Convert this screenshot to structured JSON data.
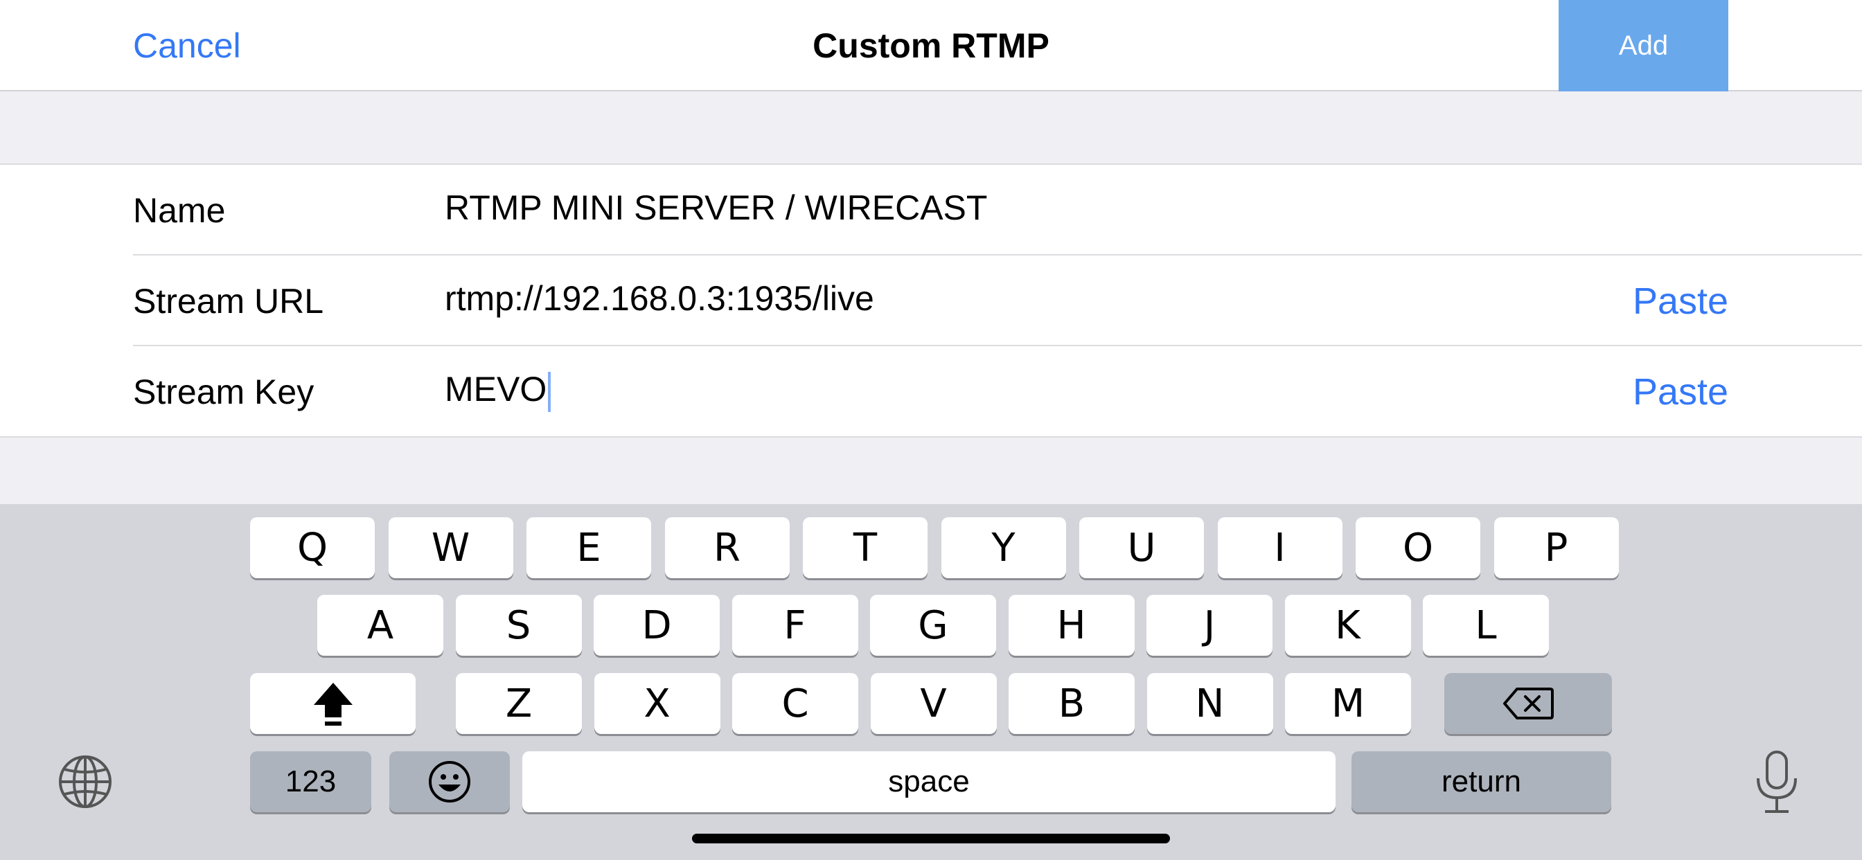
{
  "navbar": {
    "cancel_label": "Cancel",
    "title": "Custom RTMP",
    "add_label": "Add"
  },
  "form": {
    "rows": [
      {
        "label": "Name",
        "value": "RTMP MINI SERVER / WIRECAST"
      },
      {
        "label": "Stream URL",
        "value": "rtmp://192.168.0.3:1935/live",
        "action": "Paste"
      },
      {
        "label": "Stream Key",
        "value": "MEVO",
        "action": "Paste"
      }
    ]
  },
  "keyboard": {
    "row1": [
      "Q",
      "W",
      "E",
      "R",
      "T",
      "Y",
      "U",
      "I",
      "O",
      "P"
    ],
    "row2": [
      "A",
      "S",
      "D",
      "F",
      "G",
      "H",
      "J",
      "K",
      "L"
    ],
    "row3": [
      "Z",
      "X",
      "C",
      "V",
      "B",
      "N",
      "M"
    ],
    "numbers_label": "123",
    "space_label": "space",
    "return_label": "return",
    "icons": {
      "shift": "shift-icon",
      "delete": "backspace-icon",
      "emoji": "emoji-icon",
      "globe": "globe-icon",
      "mic": "microphone-icon"
    }
  },
  "colors": {
    "accent": "#3478f6",
    "add_button": "#6aa8ec",
    "group_background": "#f0eff4",
    "keyboard_background": "#d3d5db",
    "dark_key": "#adb3bc"
  }
}
